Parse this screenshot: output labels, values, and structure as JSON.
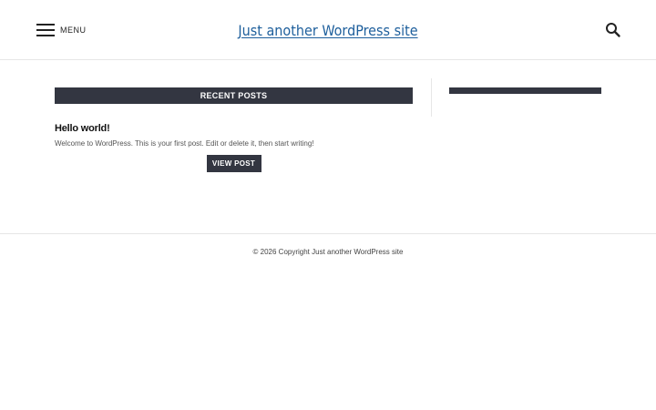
{
  "header": {
    "menu_label": "MENU",
    "menu_icon": "hamburger-icon",
    "site_title": "Just another WordPress site",
    "search_icon": "search-icon"
  },
  "main": {
    "section_heading": "RECENT POSTS",
    "posts": [
      {
        "title": "Hello world!",
        "excerpt": "Welcome to WordPress. This is your first post. Edit or delete it, then start writing!",
        "button_label": "VIEW POST"
      }
    ]
  },
  "sidebar": {
    "heading": ""
  },
  "footer": {
    "copyright": "© 2026 Copyright Just another WordPress site"
  },
  "colors": {
    "accent_dark": "#333641",
    "title_link": "#1e5f9c"
  }
}
